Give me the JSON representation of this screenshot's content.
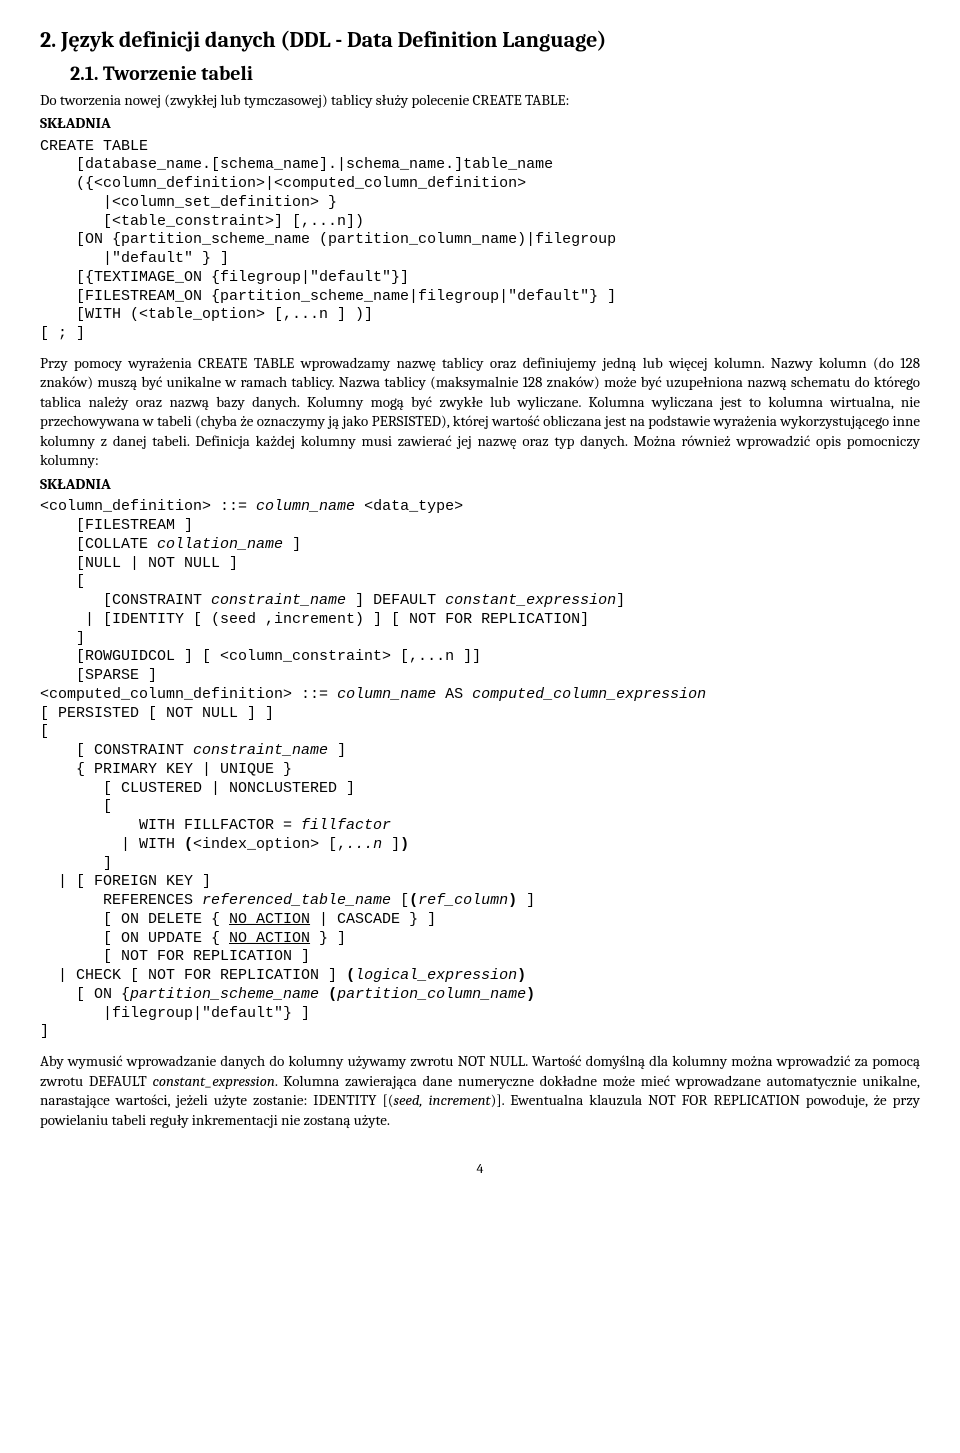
{
  "section": {
    "num_title": "2. Język definicji danych (DDL - Data Definition Language)",
    "sub_num_title": "2.1.    Tworzenie tabeli"
  },
  "p1": {
    "text": "Do tworzenia nowej (zwykłej lub tymczasowej) tablicy służy polecenie CREATE TABLE:",
    "skladnia": "SKŁADNIA"
  },
  "code1": "CREATE TABLE\n    [database_name.[schema_name].|schema_name.]table_name\n    ({<column_definition>|<computed_column_definition>\n       |<column_set_definition> }\n       [<table_constraint>] [,...n])\n    [ON {partition_scheme_name (partition_column_name)|filegroup\n       |\"default\" } ]\n    [{TEXTIMAGE_ON {filegroup|\"default\"}]\n    [FILESTREAM_ON {partition_scheme_name|filegroup|\"default\"} ]\n    [WITH (<table_option> [,...n ] )]\n[ ; ]",
  "p2": "Przy pomocy wyrażenia CREATE TABLE wprowadzamy nazwę tablicy oraz definiujemy jedną lub więcej kolumn. Nazwy kolumn (do 128 znaków) muszą być unikalne w ramach tablicy. Nazwa tablicy (maksymalnie 128 znaków) może być uzupełniona nazwą schematu do którego tablica należy oraz nazwą bazy danych. Kolumny mogą być zwykłe lub wyliczane. Kolumna wyliczana jest to kolumna wirtualna, nie przechowywana w tabeli (chyba że oznaczymy ją jako PERSISTED), której wartość obliczana jest na podstawie wyrażenia wykorzystującego inne kolumny z danej tabeli. Definicja każdej kolumny musi zawierać jej nazwę oraz typ danych. Można również wprowadzić opis pomocniczy kolumny:",
  "skladnia2": "SKŁADNIA",
  "code2": {
    "l1a": "<column_definition> ::= ",
    "l1b": "column_name",
    "l1c": " <data_type>",
    "l2": "    [FILESTREAM ]",
    "l3a": "    [COLLATE ",
    "l3b": "collation_name",
    "l3c": " ]",
    "l4": "    [NULL | NOT NULL ]",
    "l5": "    [",
    "l6a": "       [CONSTRAINT ",
    "l6b": "constraint_name",
    "l6c": " ] DEFAULT ",
    "l6d": "constant_expression",
    "l6e": "]",
    "l7": "     | [IDENTITY [ (seed ,increment) ] [ NOT FOR REPLICATION]",
    "l8": "    ]",
    "l9": "    [ROWGUIDCOL ] [ <column_constraint> [,...n ]]",
    "l10": "    [SPARSE ]",
    "l11a": "<computed_column_definition> ::= ",
    "l11b": "column_name",
    "l11c": " AS ",
    "l11d": "computed_column_expression",
    "l12": "[ PERSISTED [ NOT NULL ] ]",
    "l13": "[",
    "l14a": "    [ CONSTRAINT ",
    "l14b": "constraint_name",
    "l14c": " ]",
    "l15": "    { PRIMARY KEY | UNIQUE }",
    "l16": "       [ CLUSTERED | NONCLUSTERED ]",
    "l17": "       [",
    "l18a": "           WITH FILLFACTOR = ",
    "l18b": "fillfactor",
    "l19a": "         | WITH ",
    "l19b": "(",
    "l19c": "<index_option> [,",
    "l19d": "...n ",
    "l19e": "]",
    "l19f": ")",
    "l20": "       ]",
    "l21": "  | [ FOREIGN KEY ]",
    "l22a": "       REFERENCES ",
    "l22b": "referenced_table_name",
    "l22c": " [",
    "l22d": "(",
    "l22e": "ref_column",
    "l22f": ")",
    "l22g": " ]",
    "l23a": "       [ ON DELETE { ",
    "l23b": "NO_ACTION",
    "l23c": " | CASCADE } ]",
    "l24a": "       [ ON UPDATE { ",
    "l24b": "NO_ACTION",
    "l24c": " } ]",
    "l25": "       [ NOT FOR REPLICATION ]",
    "l26a": "  | CHECK [ NOT FOR REPLICATION ] ",
    "l26b": "(",
    "l26c": "logical_expression",
    "l26d": ")",
    "l27a": "    [ ON {",
    "l27b": "partition_scheme_name",
    "l27c": " ",
    "l27d": "(",
    "l27e": "partition_column_name",
    "l27f": ")",
    "l28": "       |filegroup|\"default\"} ]",
    "l29": "]"
  },
  "p3a": "Aby wymusić wprowadzanie danych do kolumny używamy zwrotu NOT NULL. Wartość domyślną dla kolumny można wprowadzić za pomocą zwrotu DEFAULT ",
  "p3b": "constant_expression",
  "p3c": ". Kolumna zawierająca dane numeryczne dokładne może mieć wprowadzane automatycznie unikalne, narastające wartości, jeżeli użyte zostanie: IDENTITY [(",
  "p3d": "seed, increment",
  "p3e": ")]. Ewentualna klauzula NOT FOR REPLICATION powoduje, że przy powielaniu tabeli reguły inkrementacji nie zostaną użyte.",
  "pagenum": "4"
}
